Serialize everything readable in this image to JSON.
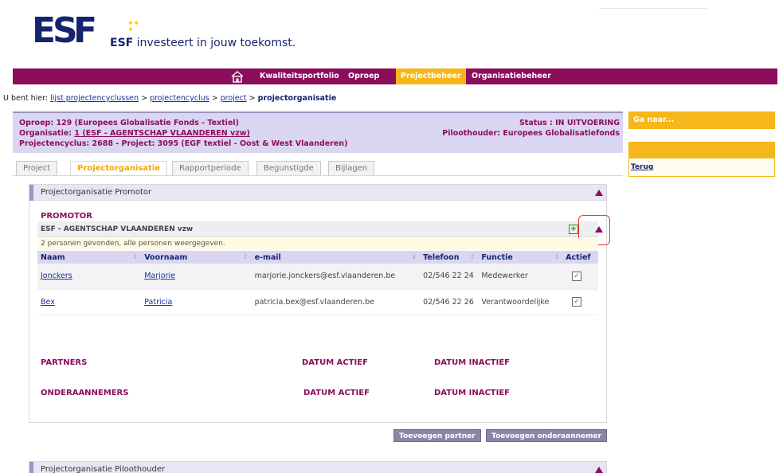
{
  "header": {
    "logo_text": "ESF",
    "tagline_bold": "ESF",
    "tagline_rest": " investeert in jouw toekomst."
  },
  "nav": {
    "items": [
      {
        "label": "Kwaliteitsportfolio"
      },
      {
        "label": "Oproep"
      },
      {
        "label": "Projectbeheer",
        "active": true
      },
      {
        "label": "Organisatiebeheer"
      }
    ]
  },
  "breadcrumb": {
    "prefix": "U bent hier:",
    "links": [
      "lijst projectencyclussen",
      "projectencyclus",
      "project"
    ],
    "separator": ">",
    "current": "projectorganisatie"
  },
  "info": {
    "oproep": "Oproep: 129 (Europees Globalisatie Fonds - Textiel)",
    "organisatie_label": "Organisatie:",
    "organisatie_link": "1 (ESF - AGENTSCHAP VLAANDEREN vzw)",
    "projectencyclus": "Projectencyclus: 2688 - Project: 3095 (EGF textiel - Oost & West Vlaanderen)",
    "status": "Status : IN UITVOERING",
    "piloothouder": "Piloothouder: Europees Globalisatiefonds"
  },
  "tabs": [
    {
      "label": "Project"
    },
    {
      "label": "Projectorganisatie",
      "active": true
    },
    {
      "label": "Rapportperiode"
    },
    {
      "label": "Begunstigde"
    },
    {
      "label": "Bijlagen"
    }
  ],
  "panel": {
    "title": "Projectorganisatie Promotor",
    "promotor_label": "PROMOTOR",
    "org_name": "ESF - AGENTSCHAP VLAANDEREN vzw",
    "count_text": "2 personen gevonden, alle personen weergegeven.",
    "columns": [
      "Naam",
      "Voornaam",
      "e-mail",
      "Telefoon",
      "Functie",
      "Actief"
    ],
    "rows": [
      {
        "naam": "Jonckers",
        "voornaam": "Marjorie",
        "email": "marjorie.jonckers@esf.vlaanderen.be",
        "telefoon": "02/546 22 24",
        "functie": "Medewerker",
        "actief": true
      },
      {
        "naam": "Bex",
        "voornaam": "Patricia",
        "email": "patricia.bex@esf.vlaanderen.be",
        "telefoon": "02/546 22 26",
        "functie": "Verantwoordelijke",
        "actief": true
      }
    ],
    "partners_label": "PARTNERS",
    "datum_actief": "DATUM ACTIEF",
    "datum_inactief": "DATUM INACTIEF",
    "onderaannemers_label": "ONDERAANNEMERS"
  },
  "buttons": {
    "add_partner": "Toevoegen partner",
    "add_subcontractor": "Toevoegen onderaannemer"
  },
  "panel2": {
    "title": "Projectorganisatie Piloothouder"
  },
  "sidebar": {
    "ganaar": "Ga naar...",
    "terug": "Terug"
  },
  "colors": {
    "brand_purple": "#8b0d5c",
    "accent_yellow": "#f5b71a",
    "navy": "#16246e"
  }
}
